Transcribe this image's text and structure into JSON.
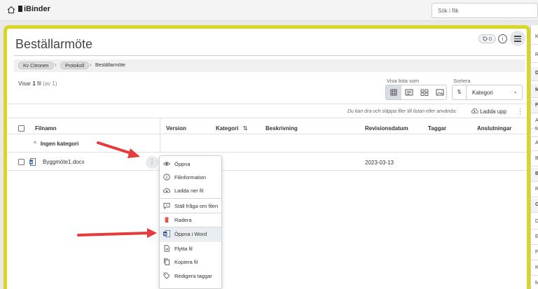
{
  "app": {
    "brand": "iBinder",
    "search_placeholder": "Sök i flik"
  },
  "header": {
    "title": "Beställarmöte",
    "tag_count": "0",
    "info_glyph": "i"
  },
  "breadcrumb": {
    "items": [
      "Kv Citronen",
      "Protokoll"
    ],
    "current": "Beställarmöte"
  },
  "listing": {
    "visar_prefix": "Visar",
    "visar_count": "1",
    "visar_unit": "fil",
    "visar_total": "(av 1)",
    "view_label": "Visa lista som",
    "sort_label": "Sortera",
    "sort_value": "Kategori",
    "drop_hint": "Du kan dra och släppa filer till listan eller använda:",
    "upload_label": "Ladda upp"
  },
  "table": {
    "columns": {
      "filename": "Filnamn",
      "version": "Version",
      "category": "Kategori",
      "description": "Beskrivning",
      "revision_date": "Revisionsdatum",
      "tags": "Taggar",
      "connections": "Anslutningar"
    },
    "group_label": "Ingen kategori",
    "rows": [
      {
        "name": "Byggmöte1.docx",
        "revision_date": "2023-03-13"
      }
    ]
  },
  "context_menu": {
    "items": [
      {
        "label": "Öppna",
        "icon": "eye-icon"
      },
      {
        "label": "Filinformation",
        "icon": "info-icon"
      },
      {
        "label": "Ladda ner fil",
        "icon": "cloud-download-icon"
      },
      {
        "label": "Ställ fråga om filen",
        "icon": "question-comment-icon"
      },
      {
        "label": "Radera",
        "icon": "trash-icon"
      },
      {
        "label": "Öppna i Word",
        "icon": "word-icon"
      },
      {
        "label": "Flytta fil",
        "icon": "move-file-icon"
      },
      {
        "label": "Kopiera fil",
        "icon": "copy-icon"
      },
      {
        "label": "Redigera taggar",
        "icon": "tag-icon"
      }
    ]
  },
  "right_panel": {
    "items": [
      "K",
      "R",
      "D",
      "M",
      "F",
      "A",
      "fo",
      "A",
      "B",
      "B",
      "R",
      "C",
      "D",
      "E",
      "F",
      "K",
      "M"
    ]
  },
  "colors": {
    "frame_yellow": "#d9d623",
    "annotation_red": "#e53b3b",
    "word_blue": "#2b5797",
    "delete_red": "#d9534f"
  }
}
